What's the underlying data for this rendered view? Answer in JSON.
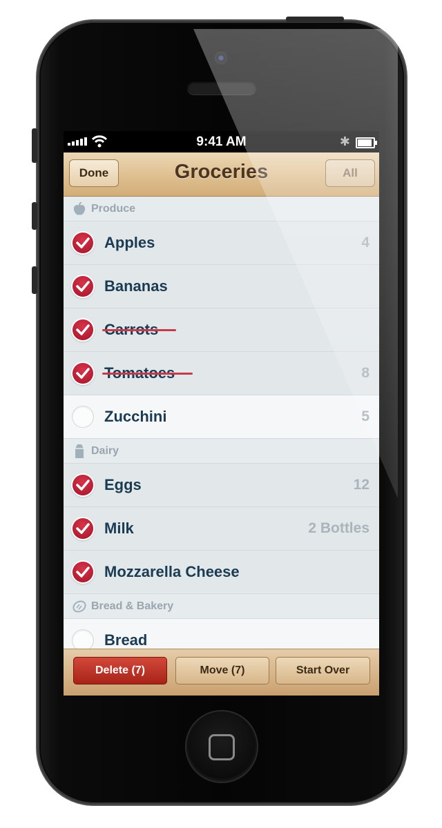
{
  "status_bar": {
    "time": "9:41 AM"
  },
  "nav": {
    "title": "Groceries",
    "done_label": "Done",
    "all_label": "All"
  },
  "sections": [
    {
      "name": "Produce",
      "icon": "apple-icon",
      "items": [
        {
          "label": "Apples",
          "qty": "4",
          "checked": true,
          "struck": false
        },
        {
          "label": "Bananas",
          "qty": "",
          "checked": true,
          "struck": false
        },
        {
          "label": "Carrots",
          "qty": "",
          "checked": true,
          "struck": true
        },
        {
          "label": "Tomatoes",
          "qty": "8",
          "checked": true,
          "struck": true
        },
        {
          "label": "Zucchini",
          "qty": "5",
          "checked": false,
          "struck": false
        }
      ]
    },
    {
      "name": "Dairy",
      "icon": "milk-carton-icon",
      "items": [
        {
          "label": "Eggs",
          "qty": "12",
          "checked": true,
          "struck": false
        },
        {
          "label": "Milk",
          "qty": "2 Bottles",
          "checked": true,
          "struck": false
        },
        {
          "label": "Mozzarella Cheese",
          "qty": "",
          "checked": true,
          "struck": false
        }
      ]
    },
    {
      "name": "Bread & Bakery",
      "icon": "bread-icon",
      "items": [
        {
          "label": "Bread",
          "qty": "",
          "checked": false,
          "struck": false
        }
      ]
    }
  ],
  "toolbar": {
    "delete_label": "Delete (7)",
    "move_label": "Move (7)",
    "start_over_label": "Start Over"
  },
  "colors": {
    "check_red": "#c2213a",
    "delete_red": "#c23528",
    "text_navy": "#1b3b52"
  }
}
